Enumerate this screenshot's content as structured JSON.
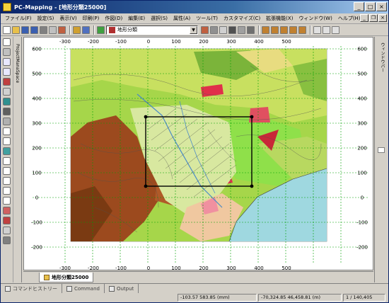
{
  "window": {
    "title": "PC-Mapping - [地形分類25000]",
    "minimize": "_",
    "maximize": "□",
    "close": "×"
  },
  "menu": [
    "ファイル(F)",
    "設定(S)",
    "表示(V)",
    "印刷(P)",
    "作図(D)",
    "編集(E)",
    "選択(S)",
    "属性(A)",
    "ツール(T)",
    "カスタマイズ(C)",
    "拡張機能(X)",
    "ウィンドウ(W)",
    "ヘルプ(H)"
  ],
  "toolbar": {
    "layer_select_value": "地形分類"
  },
  "left_panel": {
    "tab_label": "ProjectManaSpace"
  },
  "right_panel": {
    "tab_label": "ウィンドウバー"
  },
  "map": {
    "axis_top": [
      "-300",
      "-200",
      "-100",
      "0",
      "100",
      "200",
      "300",
      "400",
      "500"
    ],
    "axis_bottom": [
      "-300",
      "-200",
      "-100",
      "0",
      "100",
      "200",
      "300",
      "400",
      "500"
    ],
    "axis_left": [
      "600",
      "500",
      "400",
      "300",
      "200",
      "100",
      "0",
      "-100",
      "-200"
    ],
    "axis_right": [
      "600",
      "500",
      "400",
      "300",
      "200",
      "100",
      "0",
      "-100",
      "-200"
    ]
  },
  "doc_tab": {
    "label": "地形分類25000"
  },
  "bottom_tabs": [
    "コマンドヒストリー",
    "Command",
    "Output"
  ],
  "status": {
    "coord1": "-103.57 583.85 (mm)",
    "coord2": "-70,324.85 46,458.81 (m)",
    "scale": "1 / 140,405"
  },
  "colors": {
    "title": "#0a246a",
    "grid": "#00a000",
    "sea": "#9fd8e0",
    "green": "#a6d64a",
    "brown": "#9c4a1e",
    "select": "#000000"
  }
}
